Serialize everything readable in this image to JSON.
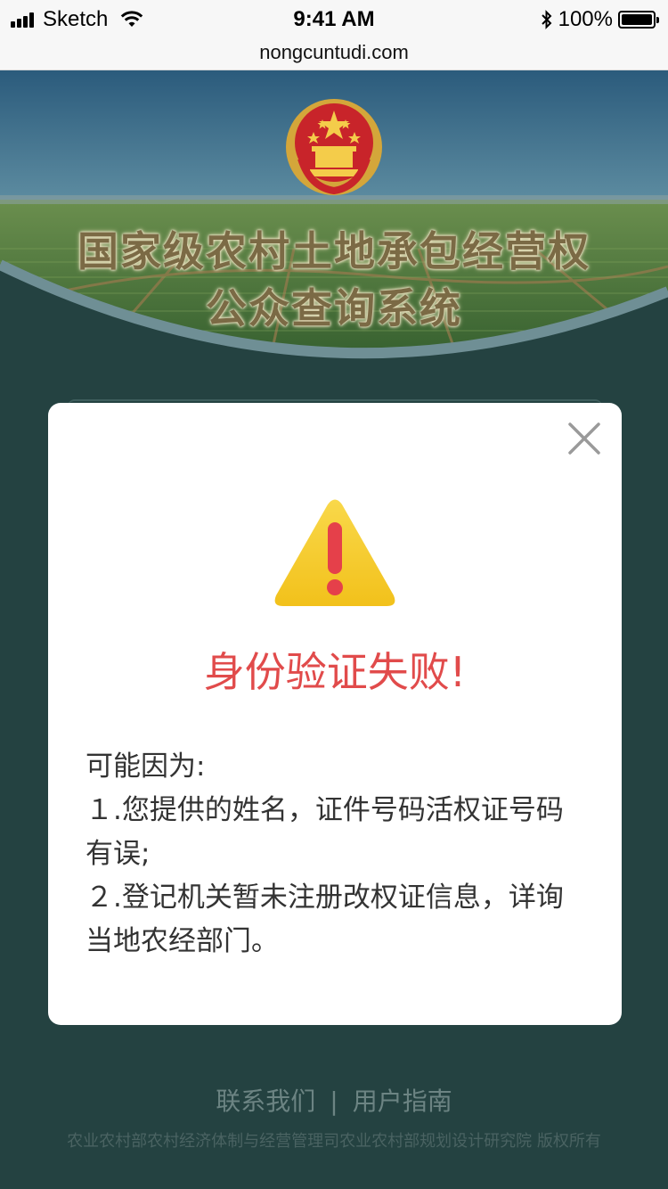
{
  "status_bar": {
    "carrier": "Sketch",
    "time": "9:41 AM",
    "battery": "100%",
    "battery_level": 1.0
  },
  "browser": {
    "url": "nongcuntudi.com"
  },
  "header": {
    "title_line1": "国家级农村土地承包经营权",
    "title_line2": "公众查询系统",
    "emblem_icon": "national-emblem-icon"
  },
  "modal": {
    "close_icon": "close-icon",
    "warning_icon": "warning-triangle-icon",
    "title": "身份验证失败!",
    "reasons_heading": "可能因为:",
    "reason_1": "１.您提供的姓名，证件号码活权证号码有误;",
    "reason_2": "２.登记机关暂未注册改权证信息，详询当地农经部门。"
  },
  "footer": {
    "contact_label": "联系我们",
    "separator": "|",
    "guide_label": "用户指南",
    "copyright": "农业农村部农村经济体制与经营管理司农业农村部规划设计研究院  版权所有"
  },
  "colors": {
    "page_bg": "#244241",
    "error_red": "#e14b4b",
    "warning_yellow": "#f6c623"
  }
}
